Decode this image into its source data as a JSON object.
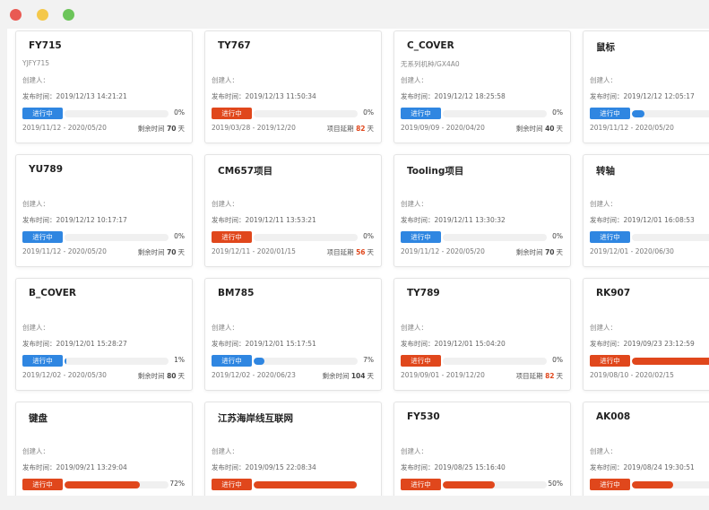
{
  "labels": {
    "creator": "创建人：",
    "published": "发布时间：",
    "remaining": "剩余时间",
    "overdue": "项目延期",
    "days": "天"
  },
  "colors": {
    "blue": "#2f86e1",
    "red": "#e0471c"
  },
  "projects": [
    {
      "title": "FY715",
      "subtitle": "YJFY715",
      "published": "2019/12/13 14:21:21",
      "status": "进行中",
      "status_color": "blue",
      "progress": 0,
      "progress_label": "0%",
      "period": "2019/11/12 - 2020/05/20",
      "remain_type": "remaining",
      "remain_days": "70"
    },
    {
      "title": "TY767",
      "subtitle": "",
      "published": "2019/12/13 11:50:34",
      "status": "进行中",
      "status_color": "red",
      "progress": 0,
      "progress_label": "0%",
      "period": "2019/03/28 - 2019/12/20",
      "remain_type": "overdue",
      "remain_days": "82"
    },
    {
      "title": "C_COVER",
      "subtitle": "无系列机种/GX4A0",
      "published": "2019/12/12 18:25:58",
      "status": "进行中",
      "status_color": "blue",
      "progress": 0,
      "progress_label": "0%",
      "period": "2019/09/09 - 2020/04/20",
      "remain_type": "remaining",
      "remain_days": "40"
    },
    {
      "title": "鼠标",
      "subtitle": "",
      "published": "2019/12/12 12:05:17",
      "status": "进行中",
      "status_color": "blue",
      "progress": 0.12,
      "progress_label": "",
      "period": "2019/11/12 - 2020/05/20",
      "remain_type": "remaining",
      "remain_days": ""
    },
    {
      "title": "YU789",
      "subtitle": "",
      "published": "2019/12/12 10:17:17",
      "status": "进行中",
      "status_color": "blue",
      "progress": 0,
      "progress_label": "0%",
      "period": "2019/11/12 - 2020/05/20",
      "remain_type": "remaining",
      "remain_days": "70"
    },
    {
      "title": "CM657项目",
      "subtitle": "",
      "published": "2019/12/11 13:53:21",
      "status": "进行中",
      "status_color": "red",
      "progress": 0,
      "progress_label": "0%",
      "period": "2019/12/11 - 2020/01/15",
      "remain_type": "overdue",
      "remain_days": "56"
    },
    {
      "title": "Tooling项目",
      "subtitle": "",
      "published": "2019/12/11 13:30:32",
      "status": "进行中",
      "status_color": "blue",
      "progress": 0,
      "progress_label": "0%",
      "period": "2019/11/12 - 2020/05/20",
      "remain_type": "remaining",
      "remain_days": "70"
    },
    {
      "title": "转轴",
      "subtitle": "",
      "published": "2019/12/01 16:08:53",
      "status": "进行中",
      "status_color": "blue",
      "progress": 0,
      "progress_label": "",
      "period": "2019/12/01 - 2020/06/30",
      "remain_type": "remaining",
      "remain_days": ""
    },
    {
      "title": "B_COVER",
      "subtitle": "",
      "published": "2019/12/01 15:28:27",
      "status": "进行中",
      "status_color": "blue",
      "progress": 0.01,
      "progress_label": "1%",
      "period": "2019/12/02 - 2020/05/30",
      "remain_type": "remaining",
      "remain_days": "80"
    },
    {
      "title": "BM785",
      "subtitle": "",
      "published": "2019/12/01 15:17:51",
      "status": "进行中",
      "status_color": "blue",
      "progress": 0.07,
      "progress_label": "7%",
      "period": "2019/12/02 - 2020/06/23",
      "remain_type": "remaining",
      "remain_days": "104"
    },
    {
      "title": "TY789",
      "subtitle": "",
      "published": "2019/12/01 15:04:20",
      "status": "进行中",
      "status_color": "red",
      "progress": 0,
      "progress_label": "0%",
      "period": "2019/09/01 - 2019/12/20",
      "remain_type": "overdue",
      "remain_days": "82"
    },
    {
      "title": "RK907",
      "subtitle": "",
      "published": "2019/09/23 23:12:59",
      "status": "进行中",
      "status_color": "red",
      "progress": 0.9,
      "progress_label": "",
      "period": "2019/08/10 - 2020/02/15",
      "remain_type": "remaining",
      "remain_days": ""
    },
    {
      "title": "键盘",
      "subtitle": "",
      "published": "2019/09/21 13:29:04",
      "status": "进行中",
      "status_color": "red",
      "progress": 0.72,
      "progress_label": "72%",
      "period": "",
      "remain_type": "",
      "remain_days": ""
    },
    {
      "title": "江苏海岸线互联网",
      "subtitle": "",
      "published": "2019/09/15 22:08:34",
      "status": "进行中",
      "status_color": "red",
      "progress": 0.99,
      "progress_label": "",
      "period": "",
      "remain_type": "",
      "remain_days": ""
    },
    {
      "title": "FY530",
      "subtitle": "",
      "published": "2019/08/25 15:16:40",
      "status": "进行中",
      "status_color": "red",
      "progress": 0.5,
      "progress_label": "50%",
      "period": "",
      "remain_type": "",
      "remain_days": ""
    },
    {
      "title": "AK008",
      "subtitle": "",
      "published": "2019/08/24 19:30:51",
      "status": "进行中",
      "status_color": "red",
      "progress": 0.4,
      "progress_label": "",
      "period": "",
      "remain_type": "",
      "remain_days": ""
    }
  ]
}
